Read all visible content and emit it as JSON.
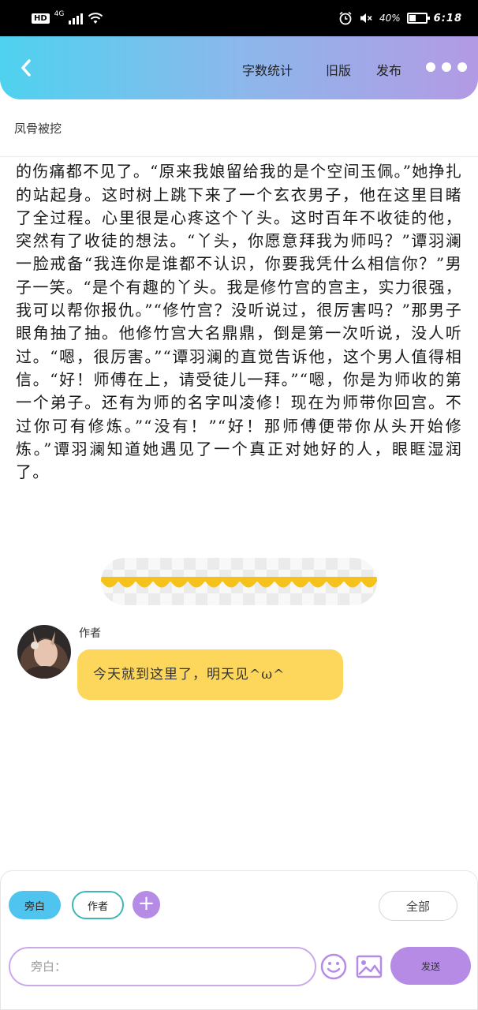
{
  "status_bar": {
    "hd": "HD",
    "network": "4G",
    "battery": "40%",
    "time": "6:18"
  },
  "header": {
    "word_count": "字数统计",
    "old_version": "旧版",
    "publish": "发布",
    "gradient": [
      "#4fd2ef",
      "#b39ae4"
    ]
  },
  "document": {
    "title": "凤骨被挖",
    "body": "那是人，一一天一一一人一了，人，一一我的人一一像身上的伤痛都不见了。“原来我娘留给我的是个空间玉佩。”她挣扎的站起身。这时树上跳下来了一个玄衣男子，他在这里目睹了全过程。心里很是心疼这个丫头。这时百年不收徒的他，突然有了收徒的想法。“丫头，你愿意拜我为师吗？”谭羽澜一脸戒备“我连你是谁都不认识，你要我凭什么相信你？”男子一笑。“是个有趣的丫头。我是修竹宫的宫主，实力很强，我可以帮你报仇。”“修竹宫？没听说过，很厉害吗？”那男子眼角抽了抽。他修竹宫大名鼎鼎，倒是第一次听说，没人听过。“嗯，很厉害。”“谭羽澜的直觉告诉他，这个男人值得相信。“好！师傅在上，请受徒儿一拜。”“嗯，你是为师收的第一个弟子。还有为师的名字叫凌修！现在为师带你回宫。不过你可有修炼。”“没有！”“好！那师傅便带你从头开始修炼。”谭羽澜知道她遇见了一个真正对她好的人，眼眶湿润了。"
  },
  "author_message": {
    "name": "作者",
    "text": "今天就到这里了，明天见^ω^",
    "bubble_color": "#fdd75c"
  },
  "composer": {
    "role_narrator": "旁白",
    "role_author": "作者",
    "add": "+",
    "all": "全部",
    "input_placeholder": "旁白：",
    "send": "发送",
    "accent": "#b58be6"
  }
}
